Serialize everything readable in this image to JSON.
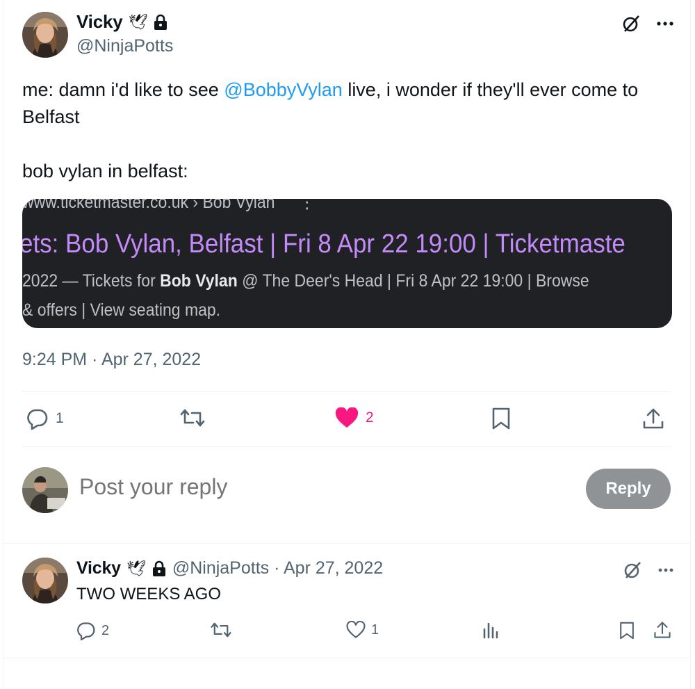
{
  "tweet": {
    "author": {
      "display_name": "Vicky",
      "handle": "@NinjaPotts",
      "name_emoji": "🕊",
      "avatar_icon": "profile-photo",
      "locked_icon": "lock-icon"
    },
    "text_before_mention": "me: damn i'd like to see ",
    "mention": "@BobbyVylan",
    "text_after_mention": " live, i wonder if they'll ever come to Belfast",
    "text_line2": "bob vylan in belfast:",
    "media": {
      "url_text": "www.ticketmaster.co.uk › Bob Vylan",
      "menu_dots": "⋮",
      "title": "ets: Bob Vylan, Belfast | Fri 8 Apr 22 19:00 | Ticketmaste",
      "snippet_prefix": "2022 — Tickets for ",
      "snippet_bold": "Bob Vylan",
      "snippet_suffix": " @ The Deer's Head | Fri 8 Apr 22 19:00 | Browse",
      "snippet_line2": "& offers | View seating map."
    },
    "timestamp": "9:24 PM · Apr 27, 2022",
    "actions": {
      "reply_count": "1",
      "retweet_count": "",
      "like_count": "2",
      "like_color": "#f91880"
    }
  },
  "reply_composer": {
    "placeholder": "Post your reply",
    "button_label": "Reply"
  },
  "reply_tweet": {
    "display_name": "Vicky",
    "name_emoji": "🕊",
    "handle_date": "@NinjaPotts · Apr 27, 2022",
    "text": "TWO WEEKS AGO",
    "actions": {
      "reply_count": "2",
      "retweet_count": "",
      "like_count": "1"
    }
  },
  "colors": {
    "accent": "#1d9bf0",
    "muted": "#536471",
    "like": "#f91880",
    "reply_button": "#8f9396"
  }
}
